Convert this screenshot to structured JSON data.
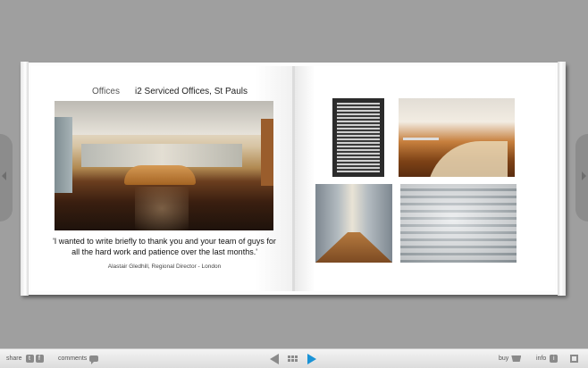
{
  "book": {
    "left_page": {
      "section": "Offices",
      "title": "i2 Serviced Offices, St Pauls",
      "quote": "'I wanted to write briefly to thank you and your team of guys for all the hard work and patience over the last months.'",
      "attribution": "Alastair Gledhill, Regional Director - London"
    }
  },
  "toolbar": {
    "share_label": "share",
    "twitter_icon_text": "t",
    "facebook_icon_text": "f",
    "comments_label": "comments",
    "buy_label": "buy",
    "info_label": "info",
    "info_icon_text": "i"
  },
  "colors": {
    "play_accent": "#1a93d6",
    "background": "#9f9f9f"
  }
}
